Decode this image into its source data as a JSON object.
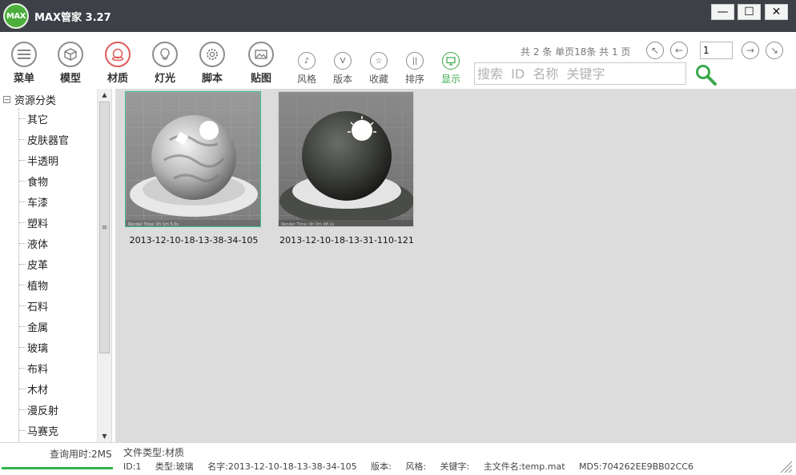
{
  "app": {
    "logo_text": "MAX",
    "title": "MAX管家 3.27"
  },
  "window_controls": {
    "minimize": "—",
    "maximize": "☐",
    "close": "✕"
  },
  "toolbar": {
    "main": [
      {
        "id": "menu",
        "label": "菜单",
        "icon": "hamburger-icon"
      },
      {
        "id": "model",
        "label": "模型",
        "icon": "cube-icon"
      },
      {
        "id": "material",
        "label": "材质",
        "icon": "material-ball-icon",
        "active": true
      },
      {
        "id": "light",
        "label": "灯光",
        "icon": "bulb-icon"
      },
      {
        "id": "script",
        "label": "脚本",
        "icon": "gear-icon"
      },
      {
        "id": "texture",
        "label": "贴图",
        "icon": "image-icon"
      }
    ],
    "secondary": [
      {
        "id": "style",
        "label": "风格",
        "glyph": "♪"
      },
      {
        "id": "version",
        "label": "版本",
        "glyph": "V"
      },
      {
        "id": "favorite",
        "label": "收藏",
        "glyph": "☆"
      },
      {
        "id": "sort",
        "label": "排序",
        "glyph": "||"
      },
      {
        "id": "display",
        "label": "显示",
        "glyph": "▭"
      }
    ]
  },
  "pagination": {
    "info": "共 2 条 单页18条 共 1 页",
    "current_page": "1"
  },
  "search": {
    "placeholder": "搜索  ID  名称  关键字"
  },
  "tree": {
    "root_toggle": "−",
    "root_label": "资源分类",
    "items": [
      "其它",
      "皮肤器官",
      "半透明",
      "食物",
      "车漆",
      "塑料",
      "液体",
      "皮革",
      "植物",
      "石料",
      "金属",
      "玻璃",
      "布料",
      "木材",
      "漫反射",
      "马赛克"
    ]
  },
  "items": [
    {
      "name": "2013-12-10-18-13-38-34-105",
      "selected": true,
      "material": "glass",
      "render_text": "Render Time: 0h 1m 5.0s"
    },
    {
      "name": "2013-12-10-18-13-31-110-121",
      "selected": false,
      "material": "granite",
      "render_text": "Render Time: 0h 0m 48.1s"
    }
  ],
  "status": {
    "query_time": "查询用时:2MS",
    "progress": 1.0,
    "file_type": "文件类型:材质",
    "details": {
      "id": "ID:1",
      "type": "类型:玻璃",
      "name": "名字:2013-12-10-18-13-38-34-105",
      "version": "版本:",
      "style": "风格:",
      "keyword": "关键字:",
      "main_file": "主文件名:temp.mat",
      "md5": "MD5:704262EE9BB02CC6"
    }
  },
  "colors": {
    "accent_green": "#2fb64a",
    "active_red": "#e05a5a",
    "selection": "#3fbf8f",
    "titlebar": "#3d4147",
    "content_bg": "#dcdcdc"
  }
}
